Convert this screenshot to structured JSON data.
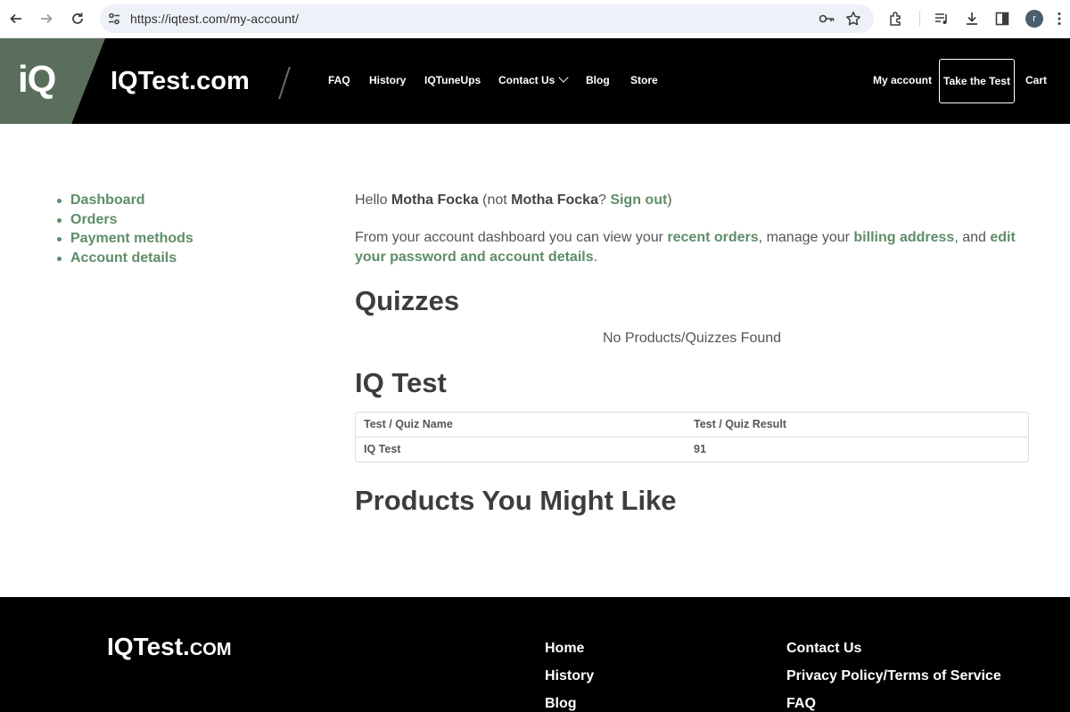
{
  "browser": {
    "url": "https://iqtest.com/my-account/",
    "profile_initial": "r"
  },
  "header": {
    "logo_text": "iQ",
    "brand": "IQTest.com",
    "menu": {
      "faq": "FAQ",
      "history": "History",
      "tuneups": "IQTuneUps",
      "contact": "Contact Us",
      "blog": "Blog",
      "store": "Store"
    },
    "my_account": "My account",
    "take_test": "Take the Test",
    "cart": "Cart"
  },
  "account_nav": {
    "dashboard": "Dashboard",
    "orders": "Orders",
    "payment_methods": "Payment methods",
    "account_details": "Account details"
  },
  "main": {
    "hello_prefix": "Hello ",
    "user_name": "Motha Focka",
    "not_prefix": " (not ",
    "user_name_2": "Motha Focka",
    "question": "? ",
    "sign_out": "Sign out",
    "close_paren": ")",
    "intro_1": "From your account dashboard you can view your ",
    "recent_orders": "recent orders",
    "intro_2": ", manage your ",
    "billing_address": "billing address",
    "intro_3": ", and ",
    "edit_password": "edit your password and account details",
    "intro_4": ".",
    "quizzes_heading": "Quizzes",
    "quizzes_empty": "No Products/Quizzes Found",
    "iq_heading": "IQ Test",
    "table": {
      "col_name": "Test / Quiz Name",
      "col_result": "Test / Quiz Result",
      "rows": [
        {
          "name": "IQ Test",
          "result": "91"
        }
      ]
    },
    "products_heading": "Products You Might Like"
  },
  "footer": {
    "brand_main": "IQTest.",
    "brand_small": "COM",
    "col1": [
      "Home",
      "History",
      "Blog"
    ],
    "col2": [
      "Contact Us",
      "Privacy Policy/Terms of Service",
      "FAQ"
    ]
  }
}
